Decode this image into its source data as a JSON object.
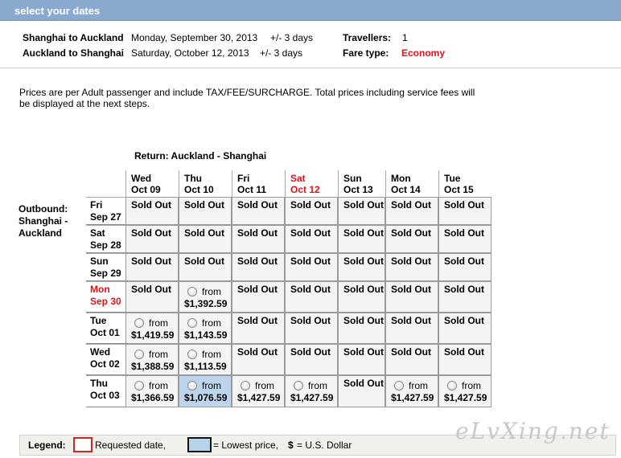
{
  "header": {
    "title": "select your dates"
  },
  "summary": {
    "route1": {
      "label": "Shanghai to Auckland",
      "date": "Monday, September 30, 2013",
      "flex": "+/- 3 days"
    },
    "route2": {
      "label": "Auckland to Shanghai",
      "date": "Saturday, October 12, 2013",
      "flex": "+/- 3 days"
    },
    "travellers_label": "Travellers:",
    "travellers_value": "1",
    "fare_label": "Fare type:",
    "fare_value": "Economy"
  },
  "notice": "Prices are per Adult passenger and include TAX/FEE/SURCHARGE. Total prices including service fees will be displayed at the next steps.",
  "grid": {
    "return_title": "Return: Auckland - Shanghai",
    "outbound_label": [
      "Outbound:",
      "Shanghai -",
      "Auckland"
    ],
    "columns": [
      {
        "day": "Wed",
        "date": "Oct 09",
        "requested": false
      },
      {
        "day": "Thu",
        "date": "Oct 10",
        "requested": false
      },
      {
        "day": "Fri",
        "date": "Oct 11",
        "requested": false
      },
      {
        "day": "Sat",
        "date": "Oct 12",
        "requested": true
      },
      {
        "day": "Sun",
        "date": "Oct 13",
        "requested": false
      },
      {
        "day": "Mon",
        "date": "Oct 14",
        "requested": false
      },
      {
        "day": "Tue",
        "date": "Oct 15",
        "requested": false
      }
    ],
    "rows": [
      {
        "day": "Fri",
        "date": "Sep 27",
        "requested": false,
        "cells": [
          "Sold Out",
          "Sold Out",
          "Sold Out",
          "Sold Out",
          "Sold Out",
          "Sold Out",
          "Sold Out"
        ]
      },
      {
        "day": "Sat",
        "date": "Sep 28",
        "requested": false,
        "cells": [
          "Sold Out",
          "Sold Out",
          "Sold Out",
          "Sold Out",
          "Sold Out",
          "Sold Out",
          "Sold Out"
        ]
      },
      {
        "day": "Sun",
        "date": "Sep 29",
        "requested": false,
        "cells": [
          "Sold Out",
          "Sold Out",
          "Sold Out",
          "Sold Out",
          "Sold Out",
          "Sold Out",
          "Sold Out"
        ]
      },
      {
        "day": "Mon",
        "date": "Sep 30",
        "requested": true,
        "cells": [
          "Sold Out",
          "$1,392.59",
          "Sold Out",
          "Sold Out",
          "Sold Out",
          "Sold Out",
          "Sold Out"
        ]
      },
      {
        "day": "Tue",
        "date": "Oct 01",
        "requested": false,
        "cells": [
          "$1,419.59",
          "$1,143.59",
          "Sold Out",
          "Sold Out",
          "Sold Out",
          "Sold Out",
          "Sold Out"
        ]
      },
      {
        "day": "Wed",
        "date": "Oct 02",
        "requested": false,
        "cells": [
          "$1,388.59",
          "$1,113.59",
          "Sold Out",
          "Sold Out",
          "Sold Out",
          "Sold Out",
          "Sold Out"
        ]
      },
      {
        "day": "Thu",
        "date": "Oct 03",
        "requested": false,
        "cells": [
          "$1,366.59",
          "$1,076.59",
          "$1,427.59",
          "$1,427.59",
          "Sold Out",
          "$1,427.59",
          "$1,427.59"
        ]
      }
    ],
    "from_label": "from",
    "lowest": {
      "row": 6,
      "col": 1
    }
  },
  "legend": {
    "title": "Legend:",
    "requested": "Requested date,",
    "lowest": "= Lowest price,",
    "currency_symbol": "$",
    "currency": "= U.S. Dollar"
  },
  "colors": {
    "header_bg": "#8aa9cf",
    "requested_red": "#e0121a",
    "lowest_blue": "#bcd5ec"
  },
  "watermark": "eLvXing.net"
}
